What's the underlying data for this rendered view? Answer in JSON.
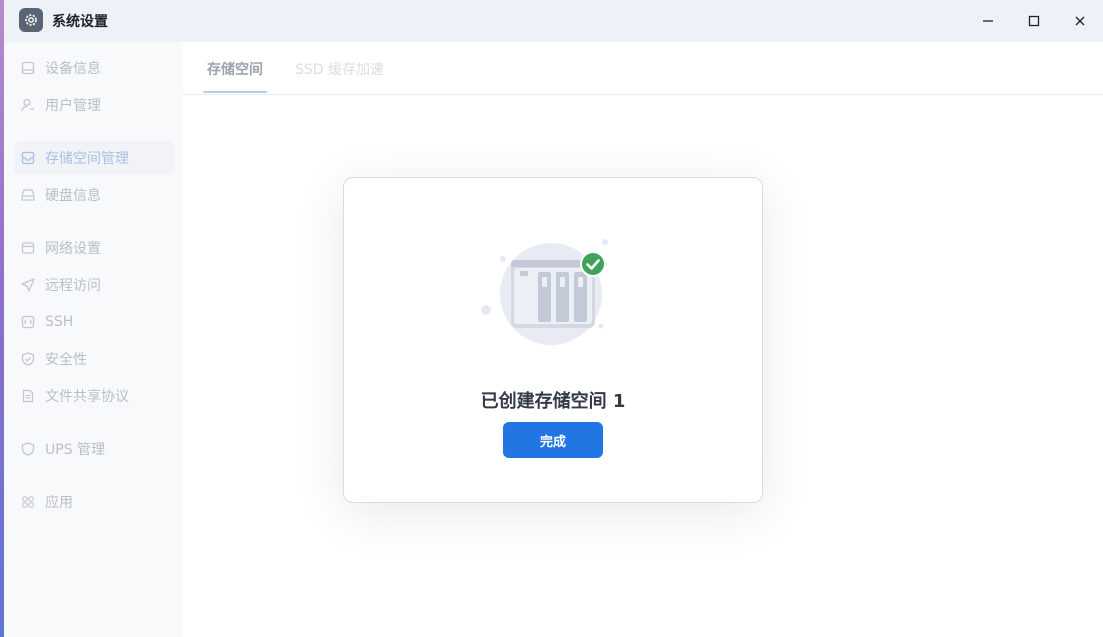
{
  "window": {
    "title": "系统设置",
    "controls": {
      "minimize": "minimize",
      "maximize": "maximize",
      "close": "close"
    }
  },
  "sidebar": {
    "items": [
      {
        "label": "设备信息",
        "icon": "device-icon"
      },
      {
        "label": "用户管理",
        "icon": "user-icon"
      },
      {
        "label": "存储空间管理",
        "icon": "storage-icon",
        "active": true
      },
      {
        "label": "硬盘信息",
        "icon": "disk-icon"
      },
      {
        "label": "网络设置",
        "icon": "network-icon"
      },
      {
        "label": "远程访问",
        "icon": "send-icon"
      },
      {
        "label": "SSH",
        "icon": "code-icon"
      },
      {
        "label": "安全性",
        "icon": "shield-check-icon"
      },
      {
        "label": "文件共享协议",
        "icon": "document-icon"
      },
      {
        "label": "UPS 管理",
        "icon": "shield-icon"
      },
      {
        "label": "应用",
        "icon": "apps-icon"
      }
    ]
  },
  "tabs": [
    {
      "label": "存储空间",
      "active": true
    },
    {
      "label": "SSD 缓存加速",
      "active": false
    }
  ],
  "dialog": {
    "message": "已创建存储空间 1",
    "button_label": "完成",
    "illustration_icon": "nas-success-icon"
  },
  "colors": {
    "accent": "#2176e3",
    "success": "#3fa35a",
    "titlebar_bg": "#eef2f8",
    "sidebar_bg": "#f8f9fb"
  }
}
